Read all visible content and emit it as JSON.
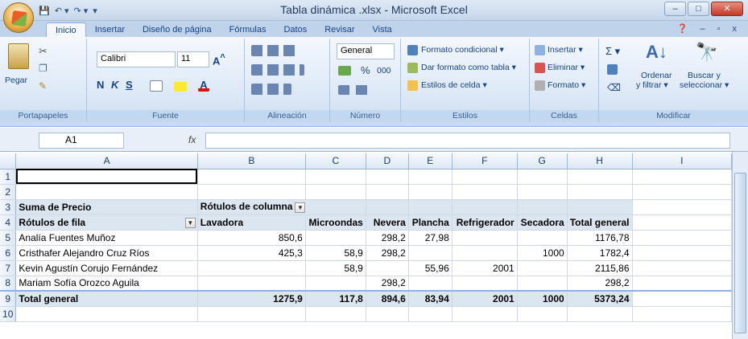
{
  "window": {
    "title": "Tabla dinámica .xlsx - Microsoft Excel",
    "minimize": "–",
    "restore": "□",
    "close": "✕"
  },
  "qat": {
    "save": "💾",
    "undo": "↶ ▾",
    "redo": "↷ ▾",
    "more": "▾"
  },
  "tabs": [
    {
      "label": "Inicio",
      "active": true
    },
    {
      "label": "Insertar"
    },
    {
      "label": "Diseño de página"
    },
    {
      "label": "Fórmulas"
    },
    {
      "label": "Datos"
    },
    {
      "label": "Revisar"
    },
    {
      "label": "Vista"
    }
  ],
  "help_controls": "❓ – ▫ x",
  "ribbon": {
    "clipboard": {
      "label": "Portapapeles",
      "paste": "Pegar"
    },
    "font": {
      "label": "Fuente",
      "name": "Calibri",
      "size": "11",
      "bold": "N",
      "italic": "K",
      "underline": "S"
    },
    "alignment": {
      "label": "Alineación"
    },
    "number": {
      "label": "Número",
      "format": "General",
      "percent": "%",
      "thousands": "000"
    },
    "styles": {
      "label": "Estilos",
      "conditional": "Formato condicional ▾",
      "table": "Dar formato como tabla ▾",
      "cell": "Estilos de celda ▾"
    },
    "cells": {
      "label": "Celdas",
      "insert": "Insertar ▾",
      "delete": "Eliminar ▾",
      "format": "Formato ▾"
    },
    "editing": {
      "label": "Modificar",
      "sort": "Ordenar",
      "sort2": "y filtrar ▾",
      "find": "Buscar y",
      "find2": "seleccionar ▾",
      "sigma": "Σ ▾"
    }
  },
  "formula_bar": {
    "name_box": "A1",
    "fx": "fx",
    "value": ""
  },
  "sheet": {
    "columns": [
      "A",
      "B",
      "C",
      "D",
      "E",
      "F",
      "G",
      "H",
      "I"
    ],
    "rows": [
      {
        "n": "1",
        "cells": [
          "",
          "",
          "",
          "",
          "",
          "",
          "",
          "",
          ""
        ]
      },
      {
        "n": "2",
        "cells": [
          "",
          "",
          "",
          "",
          "",
          "",
          "",
          "",
          ""
        ]
      },
      {
        "n": "3",
        "cells": [
          "Suma de Precio",
          "Rótulos de columna",
          "",
          "",
          "",
          "",
          "",
          "",
          ""
        ]
      },
      {
        "n": "4",
        "cells": [
          "Rótulos de fila",
          "Lavadora",
          "Microondas",
          "Nevera",
          "Plancha",
          "Refrigerador",
          "Secadora",
          "Total general",
          ""
        ]
      },
      {
        "n": "5",
        "cells": [
          "Analía Fuentes Muñoz",
          "850,6",
          "",
          "298,2",
          "27,98",
          "",
          "",
          "1176,78",
          ""
        ]
      },
      {
        "n": "6",
        "cells": [
          "Cristhafer Alejandro Cruz Ríos",
          "425,3",
          "58,9",
          "298,2",
          "",
          "",
          "1000",
          "1782,4",
          ""
        ]
      },
      {
        "n": "7",
        "cells": [
          "Kevin Agustín Corujo Fernández",
          "",
          "58,9",
          "",
          "55,96",
          "2001",
          "",
          "2115,86",
          ""
        ]
      },
      {
        "n": "8",
        "cells": [
          "Mariam Sofía Orozco Aguila",
          "",
          "",
          "298,2",
          "",
          "",
          "",
          "298,2",
          ""
        ]
      },
      {
        "n": "9",
        "cells": [
          "Total general",
          "1275,9",
          "117,8",
          "894,6",
          "83,94",
          "2001",
          "1000",
          "5373,24",
          ""
        ]
      },
      {
        "n": "10",
        "cells": [
          "",
          "",
          "",
          "",
          "",
          "",
          "",
          "",
          ""
        ]
      }
    ]
  }
}
